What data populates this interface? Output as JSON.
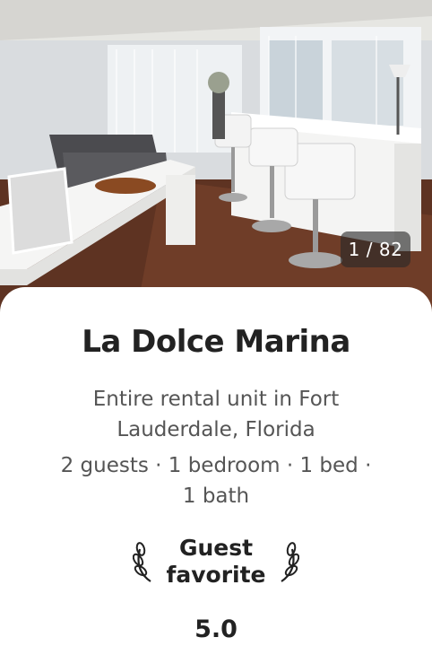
{
  "listing": {
    "photo_counter": "1 / 82",
    "title": "La Dolce Marina",
    "subtitle": "Entire rental unit in Fort Lauderdale, Florida",
    "details_line1": "2 guests · 1 bedroom · 1 bed ·",
    "details_line2": "1 bath",
    "guest_favorite_line1": "Guest",
    "guest_favorite_line2": "favorite",
    "rating": "5.0"
  },
  "icons": {
    "left_laurel": "laurel-left-icon",
    "right_laurel": "laurel-right-icon"
  },
  "colors": {
    "text_primary": "#222222",
    "text_secondary": "#555555",
    "counter_bg": "#3a3a3a"
  }
}
